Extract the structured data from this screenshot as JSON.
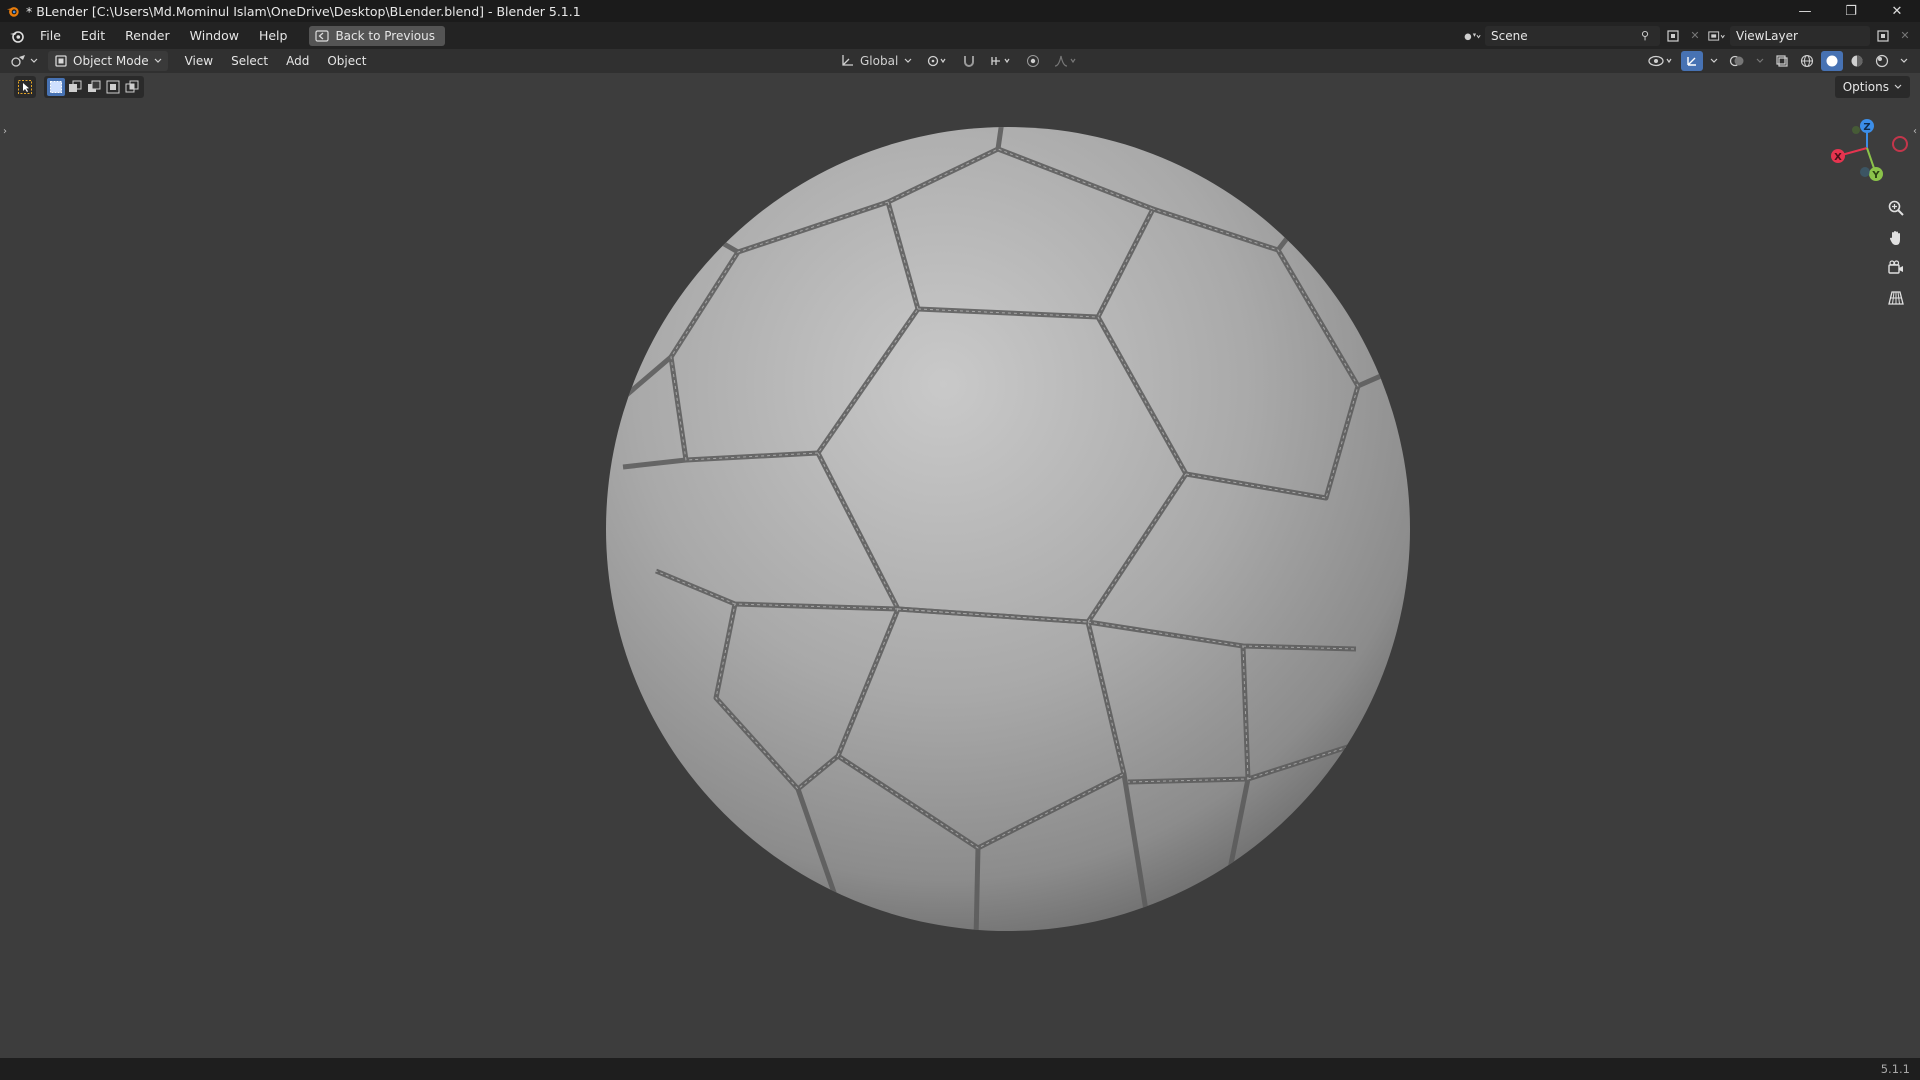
{
  "window": {
    "title": "* BLender [C:\\Users\\Md.Mominul Islam\\OneDrive\\Desktop\\BLender.blend] - Blender 5.1.1",
    "minimize": "—",
    "maximize": "❐",
    "close": "✕"
  },
  "menubar": {
    "items": [
      "File",
      "Edit",
      "Render",
      "Window",
      "Help"
    ],
    "back_button": "Back to Previous",
    "scene": "Scene",
    "view_layer": "ViewLayer"
  },
  "viewport_header": {
    "mode": "Object Mode",
    "menus": [
      "View",
      "Select",
      "Add",
      "Object"
    ],
    "transform_orientation": "Global"
  },
  "tool_options": {
    "options_label": "Options"
  },
  "gizmo": {
    "x": "X",
    "y": "Y",
    "z": "Z",
    "colors": {
      "x": "#e5344f",
      "y": "#8bc34a",
      "z": "#3c8ee8"
    }
  },
  "icons": {
    "app": "blender-logo-icon",
    "back": "back-arrow-icon",
    "editor": "viewport-editor-icon",
    "mode": "object-mode-icon",
    "zoom": "zoom-icon",
    "pan": "hand-icon",
    "camera": "camera-icon",
    "perspective": "grid-icon"
  },
  "accent": "#4772b3",
  "statusbar": {
    "version": "5.1.1"
  }
}
